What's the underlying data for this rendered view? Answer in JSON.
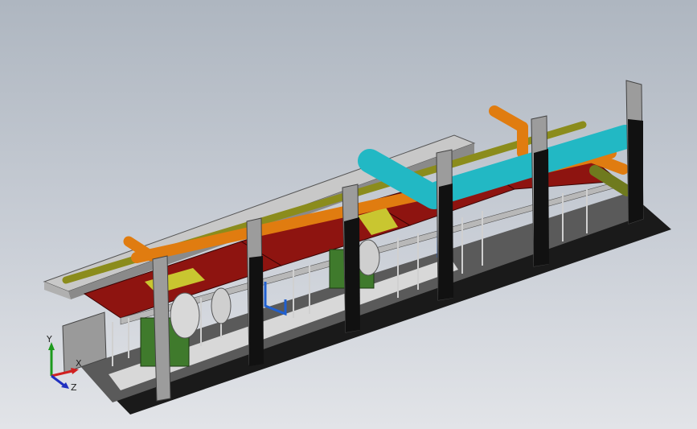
{
  "window": {
    "title": ""
  },
  "viewport": {
    "background_top": "#aeb6c0",
    "background_bottom": "#e2e4e8",
    "model_colors": {
      "frame_gray": "#9c9c9c",
      "column_black": "#111111",
      "tray_red": "#8e1410",
      "pipe_orange": "#e07c10",
      "pipe_cyan": "#22b8c4",
      "pipe_olive": "#8b8c1c",
      "motor_green": "#3f7a2c",
      "panel_yellow": "#c9c630",
      "piping_blue": "#2060d0"
    }
  },
  "triad": {
    "x_label": "X",
    "y_label": "Y",
    "z_label": "Z",
    "x_color": "#d02020",
    "y_color": "#1d9a1d",
    "z_color": "#2030c0"
  }
}
